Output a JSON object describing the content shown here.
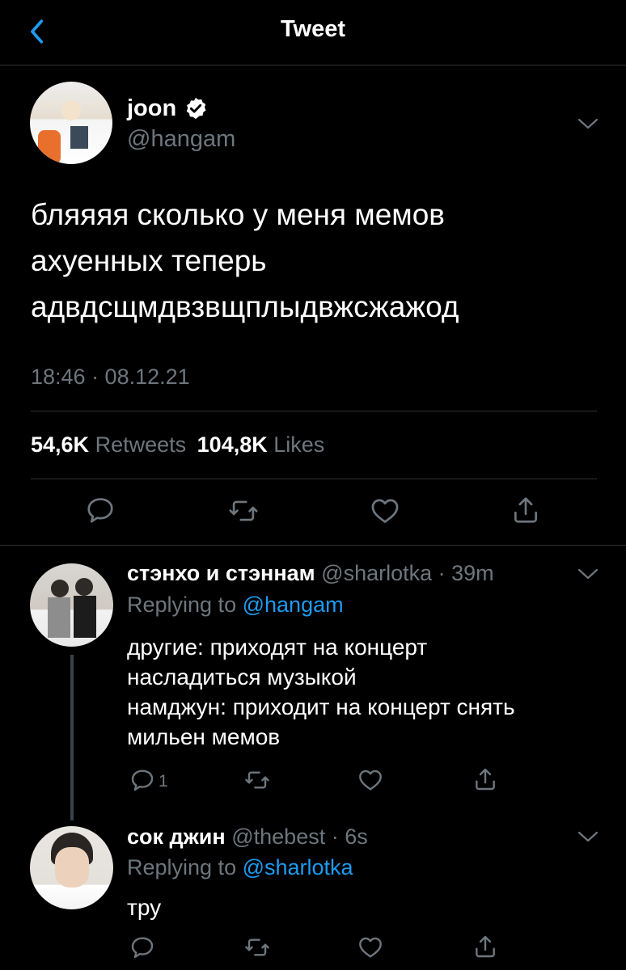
{
  "header": {
    "title": "Tweet"
  },
  "main_tweet": {
    "display_name": "joon",
    "handle": "@hangam",
    "text_lines": [
      "бляяяя сколько у меня мемов",
      "ахуенных теперь",
      "адвдсщмдвзвщплыдвжсжажод"
    ],
    "timestamp": "18:46 · 08.12.21",
    "retweets_count": "54,6K",
    "retweets_label": "Retweets",
    "likes_count": "104,8K",
    "likes_label": "Likes"
  },
  "replies": [
    {
      "display_name": "стэнхо и стэннам",
      "handle": "@sharlotka",
      "time": "· 39m",
      "replying_prefix": "Replying to",
      "replying_handle": "@hangam",
      "text_lines": [
        "другие: приходят на концерт",
        "насладиться музыкой",
        "намджун: приходит на концерт снять",
        "мильен мемов"
      ],
      "reply_count": "1"
    },
    {
      "display_name": "сок джин",
      "handle": "@thebest",
      "time": "· 6s",
      "replying_prefix": "Replying to",
      "replying_handle": "@sharlotka",
      "text_lines": [
        "тру"
      ],
      "reply_count": ""
    }
  ],
  "icons": [
    "chevron-left-icon",
    "verified-badge-icon",
    "chevron-down-icon",
    "reply-icon",
    "retweet-icon",
    "like-icon",
    "share-icon"
  ],
  "colors": {
    "background": "#000000",
    "text": "#ffffff",
    "secondary": "#6e767d",
    "accent": "#1d9bf0",
    "divider": "#2f3336"
  }
}
